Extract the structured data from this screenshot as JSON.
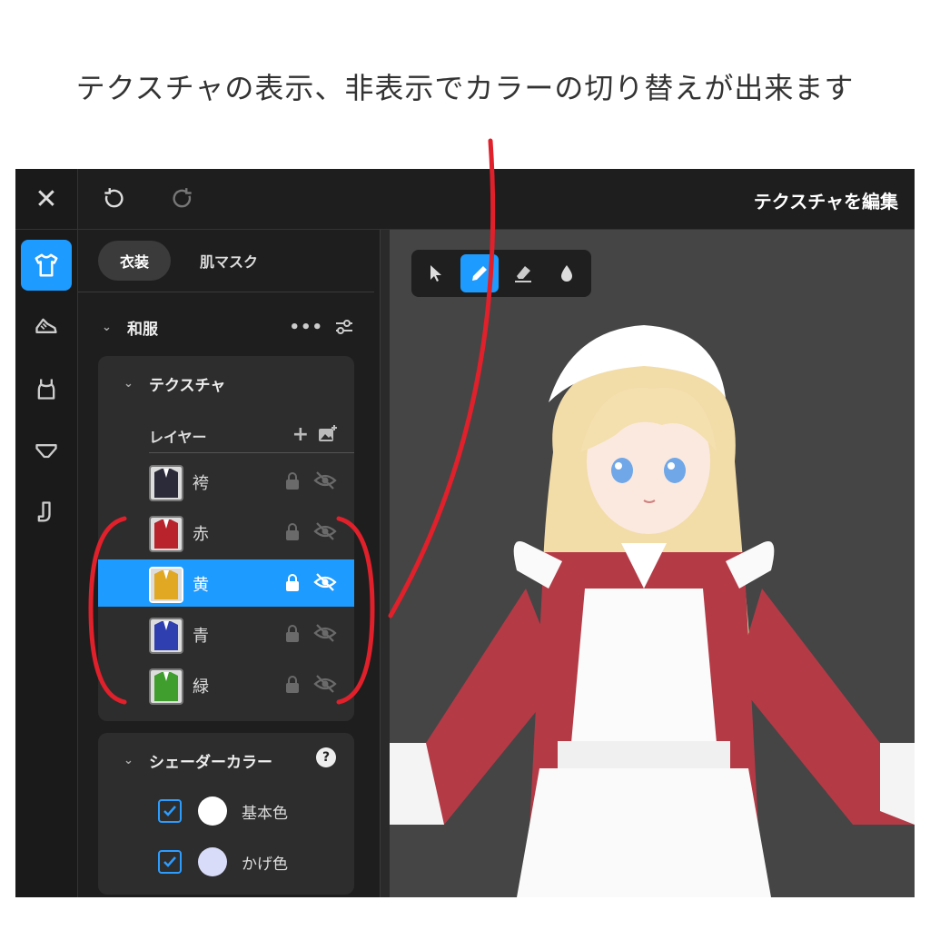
{
  "caption": "テクスチャの表示、非表示でカラーの切り替えが出来ます",
  "header": {
    "title": "テクスチャを編集"
  },
  "tabs": [
    {
      "label": "衣装",
      "active": true
    },
    {
      "label": "肌マスク",
      "active": false
    }
  ],
  "section": {
    "title": "和服"
  },
  "texture": {
    "title": "テクスチャ",
    "layers_label": "レイヤー",
    "layers": [
      {
        "name": "袴",
        "color": "#2b2b3a",
        "selected": false,
        "visible": false
      },
      {
        "name": "赤",
        "color": "#b8232c",
        "selected": false,
        "visible": false
      },
      {
        "name": "黄",
        "color": "#e0a823",
        "selected": true,
        "visible": false
      },
      {
        "name": "青",
        "color": "#2f3fb0",
        "selected": false,
        "visible": false
      },
      {
        "name": "緑",
        "color": "#3f9e2e",
        "selected": false,
        "visible": false
      }
    ]
  },
  "shader": {
    "title": "シェーダーカラー",
    "help": "?",
    "colors": [
      {
        "label": "基本色",
        "checked": true,
        "color": "#ffffff"
      },
      {
        "label": "かげ色",
        "checked": true,
        "color": "#d8dcf8"
      }
    ]
  },
  "tools": [
    {
      "icon": "cursor-icon",
      "active": false
    },
    {
      "icon": "pencil-icon",
      "active": true
    },
    {
      "icon": "eraser-icon",
      "active": false
    },
    {
      "icon": "dropper-icon",
      "active": false
    }
  ],
  "colors": {
    "accent": "#1e9bff",
    "annotation": "#e0202a",
    "background": "#1e1e1e"
  }
}
